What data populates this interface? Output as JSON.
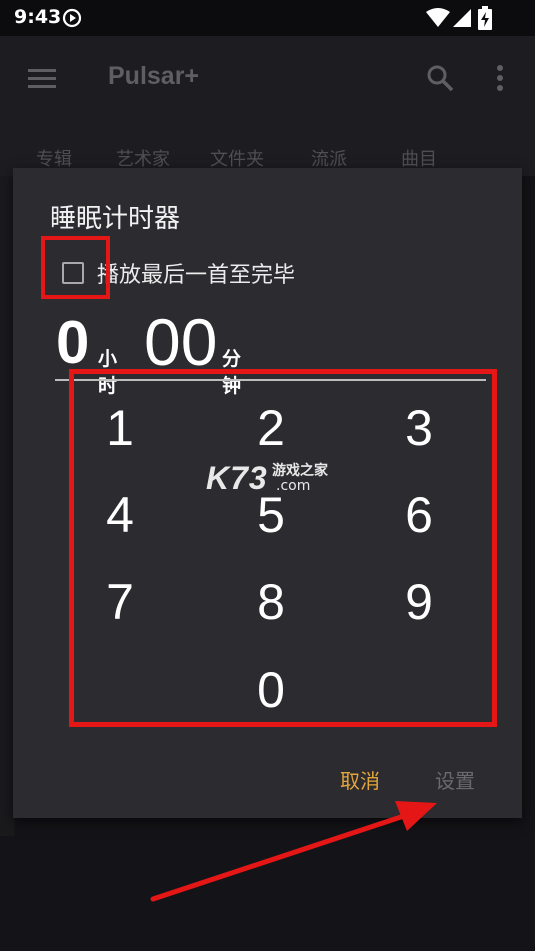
{
  "status_bar": {
    "time": "9:43"
  },
  "app_bar": {
    "title": "Pulsar+"
  },
  "tabs": [
    {
      "label": "专辑"
    },
    {
      "label": "艺术家"
    },
    {
      "label": "文件夹"
    },
    {
      "label": "流派"
    },
    {
      "label": "曲目"
    }
  ],
  "dialog": {
    "title": "睡眠计时器",
    "checkbox_label": "播放最后一首至完毕",
    "checkbox_checked": false,
    "hours_value": "0",
    "hours_unit": "小时",
    "minutes_value": "00",
    "minutes_unit": "分钟",
    "keypad": [
      "1",
      "2",
      "3",
      "4",
      "5",
      "6",
      "7",
      "8",
      "9",
      "0"
    ],
    "cancel_label": "取消",
    "set_label": "设置"
  },
  "watermark": {
    "brand": "K73",
    "text": "游戏之家",
    "domain": ".com"
  },
  "colors": {
    "accent": "#e3a63a",
    "annotation": "#e51616",
    "dialog_bg": "#2b2b30"
  }
}
